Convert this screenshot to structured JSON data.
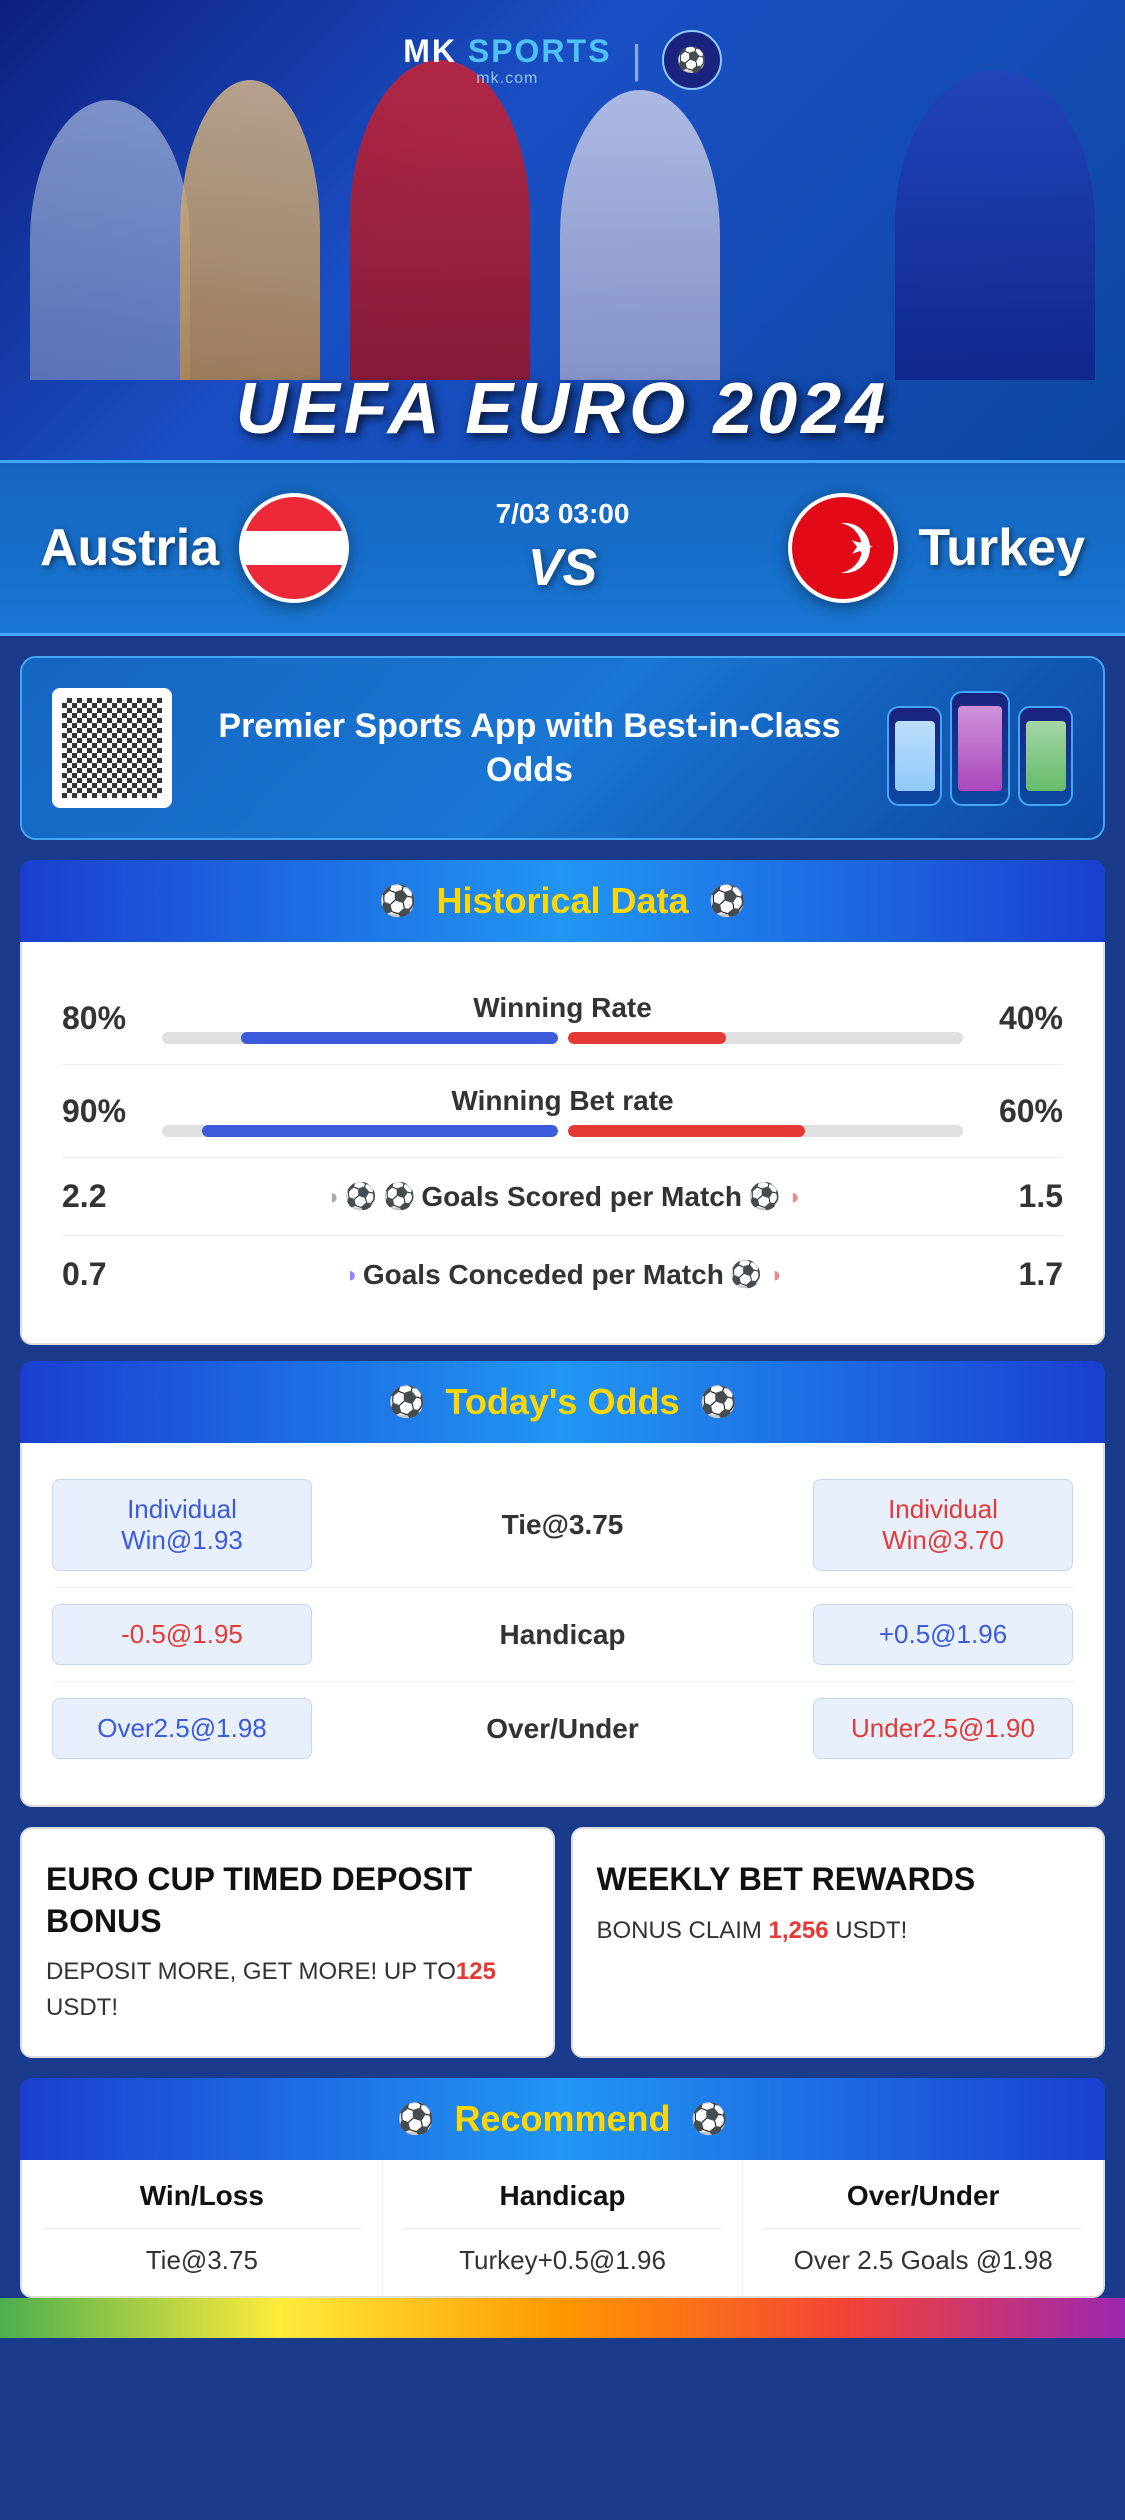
{
  "header": {
    "brand": "MK",
    "brand_sports": "SPORTS",
    "brand_url": "mk.com",
    "euro_title": "UEFA EURO 2024"
  },
  "match": {
    "team_left": "Austria",
    "team_right": "Turkey",
    "date": "7/03 03:00",
    "vs": "VS"
  },
  "app_promo": {
    "title": "Premier Sports App\nwith Best-in-Class Odds"
  },
  "historical": {
    "section_title": "Historical Data",
    "stats": [
      {
        "label": "Winning Rate",
        "left_val": "80%",
        "right_val": "40%",
        "left_pct": 80,
        "right_pct": 40
      },
      {
        "label": "Winning Bet rate",
        "left_val": "90%",
        "right_val": "60%",
        "left_pct": 90,
        "right_pct": 60
      },
      {
        "label": "Goals Scored per Match",
        "left_val": "2.2",
        "right_val": "1.5",
        "left_pct": null,
        "right_pct": null
      },
      {
        "label": "Goals Conceded per Match",
        "left_val": "0.7",
        "right_val": "1.7",
        "left_pct": null,
        "right_pct": null
      }
    ]
  },
  "odds": {
    "section_title": "Today's Odds",
    "rows": [
      {
        "left": "Individual Win@1.93",
        "center": "Tie@3.75",
        "right": "Individual Win@3.70",
        "left_color": "blue",
        "right_color": "red"
      },
      {
        "left": "-0.5@1.95",
        "center": "Handicap",
        "right": "+0.5@1.96",
        "left_color": "red",
        "right_color": "blue"
      },
      {
        "left": "Over2.5@1.98",
        "center": "Over/Under",
        "right": "Under2.5@1.90",
        "left_color": "blue",
        "right_color": "red"
      }
    ]
  },
  "bonus": {
    "card1_title": "EURO CUP TIMED\nDEPOSIT BONUS",
    "card1_desc": "DEPOSIT MORE,\nGET MORE! UP TO",
    "card1_highlight": "125",
    "card1_suffix": " USDT!",
    "card2_title": "WEEKLY BET REWARDS",
    "card2_desc": "BONUS CLAIM ",
    "card2_highlight": "1,256",
    "card2_suffix": " USDT!"
  },
  "recommend": {
    "section_title": "Recommend",
    "cols": [
      {
        "header": "Win/Loss",
        "value": "Tie@3.75"
      },
      {
        "header": "Handicap",
        "value": "Turkey+0.5@1.96"
      },
      {
        "header": "Over/Under",
        "value": "Over 2.5 Goals @1.98"
      }
    ]
  }
}
